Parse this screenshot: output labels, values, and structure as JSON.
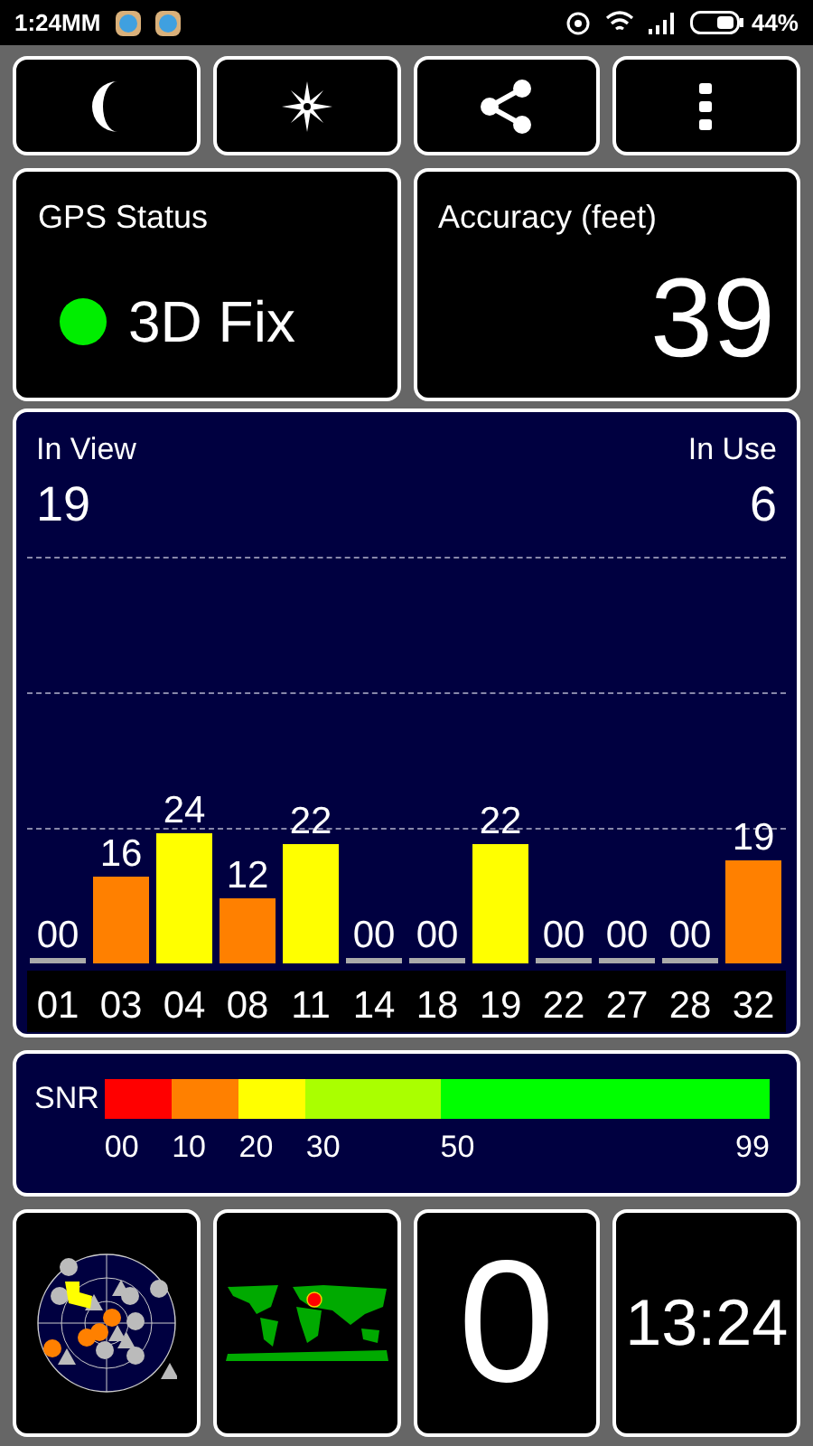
{
  "status_bar": {
    "time": "1:24MM",
    "battery": "44%"
  },
  "toolbar": [
    {
      "kind": "moon"
    },
    {
      "kind": "compass"
    },
    {
      "kind": "share"
    },
    {
      "kind": "more"
    }
  ],
  "gps_status": {
    "title": "GPS Status",
    "value": "3D Fix",
    "color": "#00ee00"
  },
  "accuracy": {
    "title": "Accuracy (feet)",
    "value": "39"
  },
  "satellites": {
    "in_view_label": "In View",
    "in_view": "19",
    "in_use_label": "In Use",
    "in_use": "6",
    "chart_data": {
      "type": "bar",
      "categories": [
        "01",
        "03",
        "04",
        "08",
        "11",
        "14",
        "18",
        "19",
        "22",
        "27",
        "28",
        "32"
      ],
      "values": [
        0,
        16,
        24,
        12,
        22,
        0,
        0,
        22,
        0,
        0,
        0,
        19
      ],
      "value_labels": [
        "00",
        "16",
        "24",
        "12",
        "22",
        "00",
        "00",
        "22",
        "00",
        "00",
        "00",
        "19"
      ],
      "data_labels": true
    }
  },
  "snr_legend": {
    "label": "SNR",
    "segments": [
      {
        "label": "00",
        "color": "#ff0000"
      },
      {
        "label": "10",
        "color": "#ff8000"
      },
      {
        "label": "20",
        "color": "#ffff00"
      },
      {
        "label": "30",
        "color": "#aaff00"
      },
      {
        "label": "50",
        "color": "#00ff00"
      }
    ],
    "end_label": "99"
  },
  "tiles": [
    {
      "kind": "radar"
    },
    {
      "kind": "map"
    },
    {
      "kind": "text",
      "text": "0"
    },
    {
      "kind": "text",
      "text": "13:24"
    }
  ]
}
